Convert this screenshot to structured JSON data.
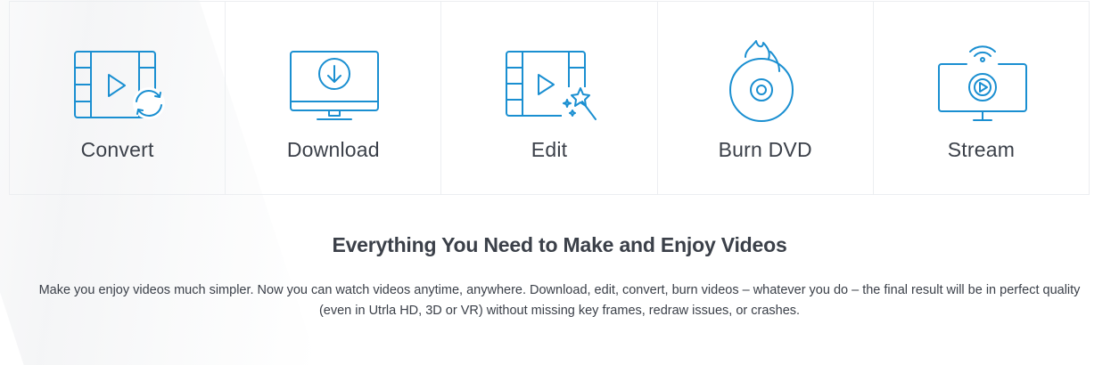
{
  "features": [
    {
      "label": "Convert",
      "icon": "convert-icon"
    },
    {
      "label": "Download",
      "icon": "download-icon"
    },
    {
      "label": "Edit",
      "icon": "edit-icon"
    },
    {
      "label": "Burn DVD",
      "icon": "burn-dvd-icon"
    },
    {
      "label": "Stream",
      "icon": "stream-icon"
    }
  ],
  "section": {
    "title": "Everything You Need to Make and Enjoy Videos",
    "description": "Make you enjoy videos much simpler. Now you can watch videos anytime, anywhere. Download, edit, convert, burn videos – whatever you do – the final result will be in perfect quality (even in Utrla HD, 3D or VR) without missing key frames, redraw issues, or crashes."
  },
  "colors": {
    "accent": "#1a8fd1",
    "text": "#3b4049",
    "border": "#eceef1"
  }
}
